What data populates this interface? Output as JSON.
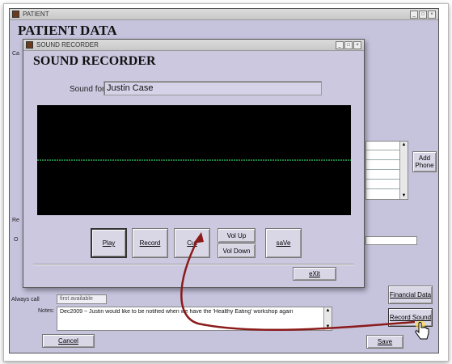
{
  "patient_window": {
    "title": "PATIENT",
    "heading": "PATIENT DATA",
    "add_phone_button": "Add Phone",
    "always_call_label": "Always call",
    "always_call_value": "first available",
    "notes_label": "Notes:",
    "notes_text": "Dec2009 ~ Justin would like to be notified when we have the 'Healthy Eating' workshop again",
    "financial_data_button": "Financial Data",
    "record_sound_button": "Record Sound",
    "cancel_button": "Cancel",
    "save_button": "Save"
  },
  "recorder_window": {
    "title": "SOUND RECORDER",
    "heading": "SOUND RECORDER",
    "sound_for_label": "Sound for",
    "sound_for_value": "Justin Case",
    "buttons": {
      "play": "Play",
      "record": "Record",
      "cut": "Cut",
      "vol_up": "Vol Up",
      "vol_down": "Vol Down",
      "save": "saVe",
      "exit": "eXit"
    }
  },
  "colors": {
    "window_bg": "#c6c3dd",
    "waveform_bg": "#000000",
    "waveform_line": "#33cc66",
    "arrow": "#8b1a1a"
  }
}
